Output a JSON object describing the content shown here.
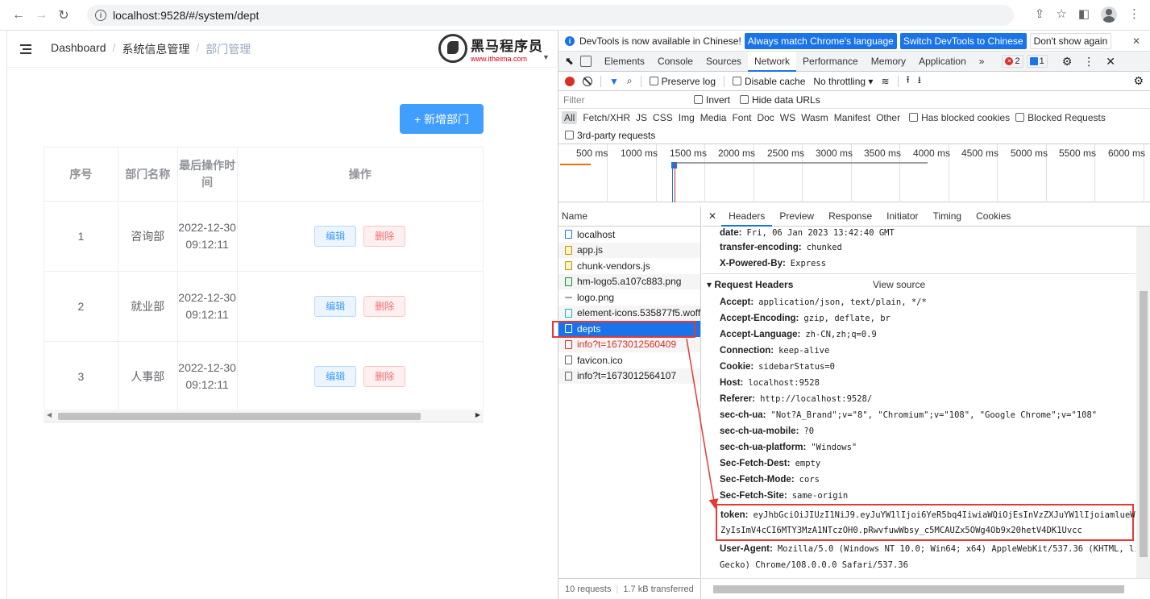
{
  "browser": {
    "url": "localhost:9528/#/system/dept"
  },
  "app": {
    "breadcrumb": [
      "Dashboard",
      "系统信息管理",
      "部门管理"
    ],
    "logo_cn": "黑马程序员",
    "logo_url": "www.itheima.com",
    "add_button": "+ 新增部门",
    "table": {
      "headers": [
        "序号",
        "部门名称",
        "最后操作时间",
        "操作"
      ],
      "rows": [
        {
          "no": "1",
          "name": "咨询部",
          "time": "2022-12-30 09:12:11"
        },
        {
          "no": "2",
          "name": "就业部",
          "time": "2022-12-30 09:12:11"
        },
        {
          "no": "3",
          "name": "人事部",
          "time": "2022-12-30 09:12:11"
        }
      ],
      "edit_label": "编辑",
      "delete_label": "删除"
    }
  },
  "devtools": {
    "infobar": {
      "text": "DevTools is now available in Chinese!",
      "btn1": "Always match Chrome's language",
      "btn2": "Switch DevTools to Chinese",
      "btn3": "Don't show again"
    },
    "tabs": [
      "Elements",
      "Console",
      "Sources",
      "Network",
      "Performance",
      "Memory",
      "Application"
    ],
    "more": "»",
    "error_count": "2",
    "message_count": "1",
    "toolbar": {
      "preserve_log": "Preserve log",
      "disable_cache": "Disable cache",
      "throttling": "No throttling"
    },
    "filter": {
      "placeholder": "Filter",
      "invert": "Invert",
      "hide_data_urls": "Hide data URLs",
      "types": [
        "All",
        "Fetch/XHR",
        "JS",
        "CSS",
        "Img",
        "Media",
        "Font",
        "Doc",
        "WS",
        "Wasm",
        "Manifest",
        "Other"
      ],
      "blocked_cookies": "Has blocked cookies",
      "blocked_requests": "Blocked Requests",
      "third_party": "3rd-party requests"
    },
    "timeline_labels": [
      "500 ms",
      "1000 ms",
      "1500 ms",
      "2000 ms",
      "2500 ms",
      "3000 ms",
      "3500 ms",
      "4000 ms",
      "4500 ms",
      "5000 ms",
      "5500 ms",
      "6000 ms"
    ],
    "list_header": "Name",
    "requests": [
      {
        "name": "localhost",
        "type": "doc"
      },
      {
        "name": "app.js",
        "type": "js"
      },
      {
        "name": "chunk-vendors.js",
        "type": "js"
      },
      {
        "name": "hm-logo5.a107c883.png",
        "type": "img"
      },
      {
        "name": "logo.png",
        "type": "img"
      },
      {
        "name": "element-icons.535877f5.woff",
        "type": "font"
      },
      {
        "name": "depts",
        "type": "selected"
      },
      {
        "name": "info?t=1673012560409",
        "type": "err"
      },
      {
        "name": "favicon.ico",
        "type": "img"
      },
      {
        "name": "info?t=1673012564107",
        "type": "doc"
      }
    ],
    "footer_requests": "10 requests",
    "footer_transferred": "1.7 kB transferred",
    "detail_tabs": [
      "Headers",
      "Preview",
      "Response",
      "Initiator",
      "Timing",
      "Cookies"
    ],
    "response_headers": [
      {
        "k": "date:",
        "v": "Fri, 06 Jan 2023 13:42:40 GMT"
      },
      {
        "k": "transfer-encoding:",
        "v": "chunked"
      },
      {
        "k": "X-Powered-By:",
        "v": "Express"
      }
    ],
    "request_headers_title": "▾ Request Headers",
    "view_source": "View source",
    "request_headers": [
      {
        "k": "Accept:",
        "v": "application/json, text/plain, */*"
      },
      {
        "k": "Accept-Encoding:",
        "v": "gzip, deflate, br"
      },
      {
        "k": "Accept-Language:",
        "v": "zh-CN,zh;q=0.9"
      },
      {
        "k": "Connection:",
        "v": "keep-alive"
      },
      {
        "k": "Cookie:",
        "v": "sidebarStatus=0"
      },
      {
        "k": "Host:",
        "v": "localhost:9528"
      },
      {
        "k": "Referer:",
        "v": "http://localhost:9528/"
      },
      {
        "k": "sec-ch-ua:",
        "v": "\"Not?A_Brand\";v=\"8\", \"Chromium\";v=\"108\", \"Google Chrome\";v=\"108\""
      },
      {
        "k": "sec-ch-ua-mobile:",
        "v": "?0"
      },
      {
        "k": "sec-ch-ua-platform:",
        "v": "\"Windows\""
      },
      {
        "k": "Sec-Fetch-Dest:",
        "v": "empty"
      },
      {
        "k": "Sec-Fetch-Mode:",
        "v": "cors"
      },
      {
        "k": "Sec-Fetch-Site:",
        "v": "same-origin"
      }
    ],
    "token": {
      "k": "token:",
      "line1": "eyJhbGciOiJIUzI1NiJ9.eyJuYW1lIjoi6YeR5bq4IiwiaWQiOjEsInVzZXJuYW1lIjoiamlueW9u",
      "line2": "ZyIsImV4cCI6MTY3MzA1NTczOH0.pRwvfuwWbsy_c5MCAUZx5OWg4Ob9x20hetV4DK1Uvcc"
    },
    "user_agent": {
      "k": "User-Agent:",
      "line1": "Mozilla/5.0 (Windows NT 10.0; Win64; x64) AppleWebKit/537.36 (KHTML, like",
      "line2": "Gecko) Chrome/108.0.0.0 Safari/537.36"
    }
  },
  "colors": {
    "primary": "#409eff",
    "danger": "#f56c6c",
    "devtools_blue": "#1a73e8",
    "annotation_red": "#e53935"
  }
}
